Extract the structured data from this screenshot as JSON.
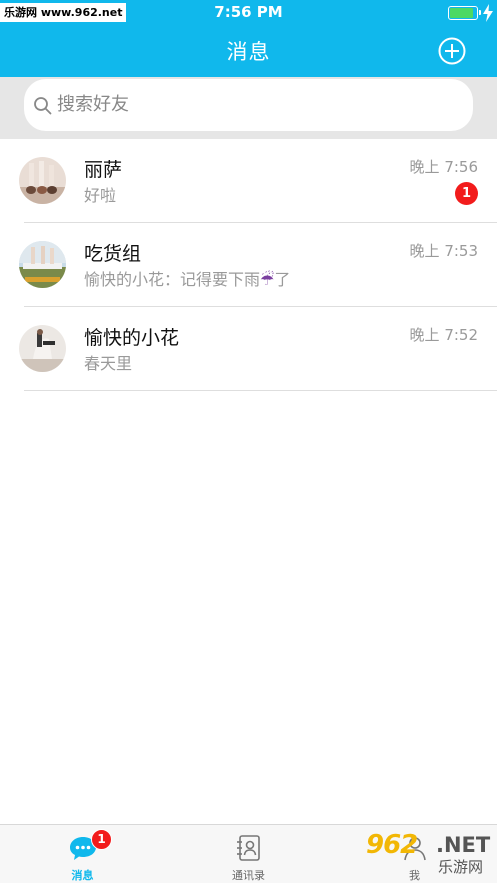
{
  "status_bar": {
    "watermark": "乐游网 www.962.net",
    "time": "7:56 PM",
    "battery_level": 0.9,
    "battery_color": "#4cd964"
  },
  "header": {
    "title": "消息",
    "add_icon": "plus-circle-icon",
    "color": "#10b8ec"
  },
  "search": {
    "placeholder": "搜索好友",
    "icon": "search-icon"
  },
  "conversations": [
    {
      "name": "丽萨",
      "message": "好啦",
      "time": "晚上 7:56",
      "unread": "1"
    },
    {
      "name": "吃货组",
      "message": "愉快的小花：记得要下雨",
      "message_suffix": "了",
      "emoji": "☔",
      "time": "晚上 7:53",
      "unread": null
    },
    {
      "name": "愉快的小花",
      "message": "春天里",
      "time": "晚上 7:52",
      "unread": null
    }
  ],
  "tabbar": {
    "tabs": [
      {
        "label": "消息",
        "icon": "chat-bubble-icon",
        "active": true,
        "badge": "1"
      },
      {
        "label": "通讯录",
        "icon": "contacts-book-icon",
        "active": false
      },
      {
        "label": "我",
        "icon": "profile-icon",
        "active": false
      }
    ],
    "active_color": "#10b8ec"
  },
  "watermark_bottom": {
    "brand": "962",
    "suffix": ".NET",
    "name": "乐游网"
  }
}
